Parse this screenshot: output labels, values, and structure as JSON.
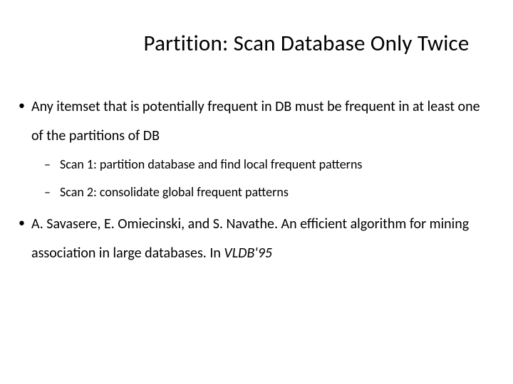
{
  "title": "Partition: Scan Database Only Twice",
  "bullets": [
    {
      "text": "Any itemset that is potentially frequent in DB must be frequent in at least one of the partitions of DB",
      "sub": [
        "Scan 1: partition database and find local frequent patterns",
        "Scan 2: consolidate global frequent patterns"
      ]
    },
    {
      "parts": {
        "pre": "A. Savasere, E. Omiecinski, and S. Navathe. ",
        "title": "An efficient algorithm for mining association in large databases",
        "post": ". In ",
        "venue": "VLDB'95"
      }
    }
  ]
}
